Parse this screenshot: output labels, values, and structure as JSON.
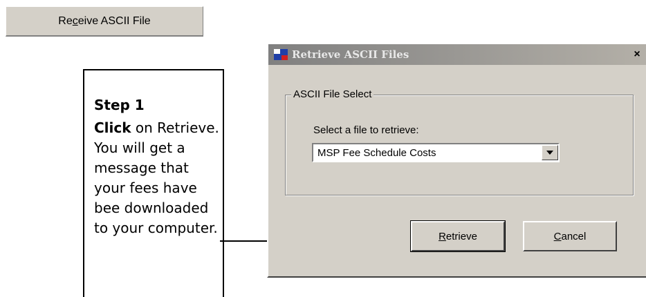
{
  "top_button": {
    "pre": "Re",
    "accel": "c",
    "post": "eive ASCII File"
  },
  "step": {
    "title": "Step 1",
    "bold_word": "Click",
    "text": " on Retrieve. You will get a message that your fees have bee downloaded to your computer."
  },
  "dialog": {
    "title": "Retrieve ASCII Files",
    "close": "×",
    "group_label": "ASCII File Select",
    "select_label": "Select a file to retrieve:",
    "select_value": "MSP Fee Schedule Costs",
    "retrieve": {
      "accel": "R",
      "rest": "etrieve"
    },
    "cancel": {
      "accel": "C",
      "rest": "ancel"
    }
  }
}
